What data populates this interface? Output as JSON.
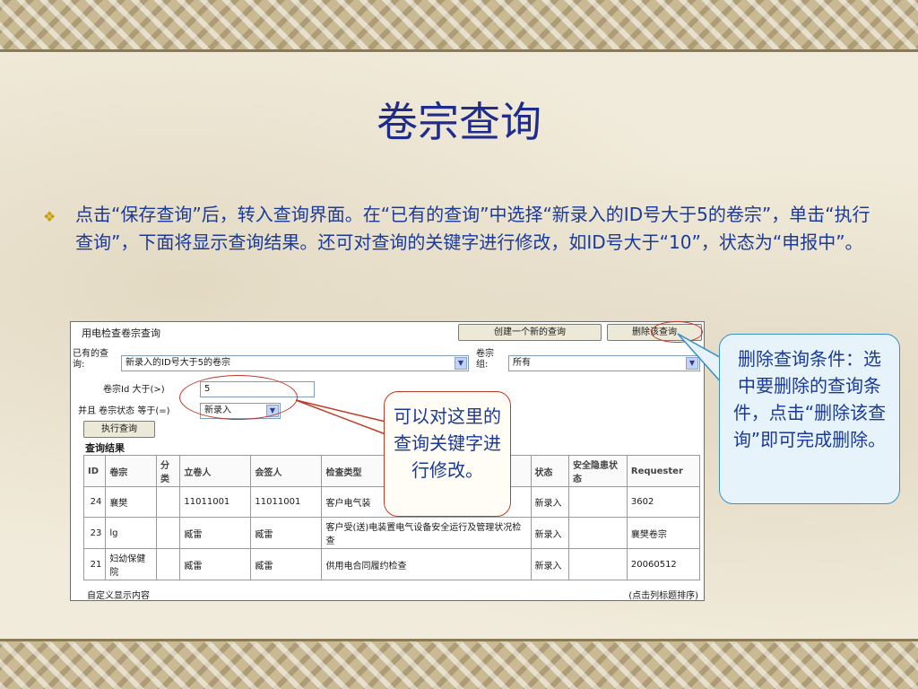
{
  "slide": {
    "title": "卷宗查询",
    "bullet": "点击“保存查询”后，转入查询界面。在“已有的查询”中选择“新录入的ID号大于5的卷宗”，单击“执行查询”，下面将显示查询结果。还可对查询的关键字进行修改，如ID号大于“10”，状态为“申报中”。"
  },
  "panel": {
    "title": "用电检查卷宗查询",
    "create_button": "创建一个新的查询",
    "delete_button": "删除该查询",
    "existing_query_label": "已有的查询:",
    "existing_query_value": "新录入的ID号大于5的卷宗",
    "group_label": "卷宗组:",
    "group_value": "所有",
    "id_condition_label": "卷宗Id 大于(>)",
    "id_condition_value": "5",
    "status_condition_label": "并且 卷宗状态 等于(=)",
    "status_condition_value": "新录入",
    "execute_button": "执行查询",
    "results_title": "查询结果",
    "columns": [
      "ID",
      "卷宗",
      "分类",
      "立卷人",
      "会签人",
      "检查类型",
      "状态",
      "安全隐患状态",
      "Requester"
    ],
    "rows": [
      [
        "24",
        "襄樊",
        "",
        "11011001",
        "11011001",
        "客户电气装",
        "新录入",
        "",
        "3602"
      ],
      [
        "23",
        "lg",
        "",
        "臧雷",
        "臧雷",
        "客户受(送)电装置电气设备安全运行及管理状况检查",
        "新录入",
        "",
        "襄樊卷宗"
      ],
      [
        "21",
        "妇幼保健院",
        "",
        "臧雷",
        "臧雷",
        "供用电合同履约检查",
        "新录入",
        "",
        "20060512"
      ]
    ],
    "footer_left": "自定义显示内容",
    "footer_right": "(点击列标题排序)"
  },
  "callouts": {
    "middle": "可以对这里的查询关键字进行修改。",
    "right": "删除查询条件：选中要删除的查询条件，点击“删除该查询”即可完成删除。"
  },
  "icons": {
    "bullet": "diamond-bullet-icon",
    "dropdown": "chevron-down-icon"
  },
  "colors": {
    "title": "#1f2c8c",
    "text": "#1a3a9a",
    "callout_red": "#c0392b",
    "callout_blue": "#3a8fc7"
  }
}
